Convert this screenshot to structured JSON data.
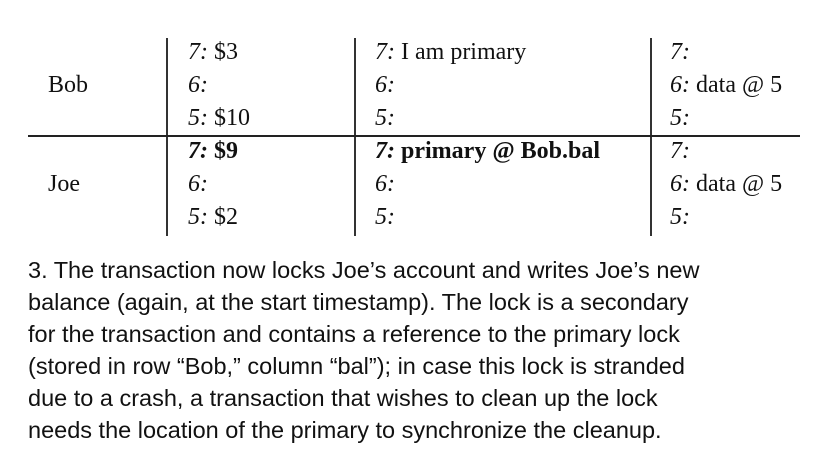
{
  "table": {
    "rows": [
      {
        "label": "Bob",
        "columns": [
          [
            {
              "ts": "7:",
              "val": " $3",
              "bold": false
            },
            {
              "ts": "6:",
              "val": "",
              "bold": false
            },
            {
              "ts": "5:",
              "val": " $10",
              "bold": false
            }
          ],
          [
            {
              "ts": "7:",
              "val": " I am primary",
              "bold": false
            },
            {
              "ts": "6:",
              "val": "",
              "bold": false
            },
            {
              "ts": "5:",
              "val": "",
              "bold": false
            }
          ],
          [
            {
              "ts": "7:",
              "val": "",
              "bold": false
            },
            {
              "ts": "6:",
              "val": " data @ 5",
              "bold": false
            },
            {
              "ts": "5:",
              "val": "",
              "bold": false
            }
          ]
        ]
      },
      {
        "label": "Joe",
        "columns": [
          [
            {
              "ts": "7:",
              "val": " $9",
              "bold": true
            },
            {
              "ts": "6:",
              "val": "",
              "bold": false
            },
            {
              "ts": "5:",
              "val": " $2",
              "bold": false
            }
          ],
          [
            {
              "ts": "7:",
              "val": " primary @ Bob.bal",
              "bold": true
            },
            {
              "ts": "6:",
              "val": "",
              "bold": false
            },
            {
              "ts": "5:",
              "val": "",
              "bold": false
            }
          ],
          [
            {
              "ts": "7:",
              "val": "",
              "bold": false
            },
            {
              "ts": "6:",
              "val": " data @ 5",
              "bold": false
            },
            {
              "ts": "5:",
              "val": "",
              "bold": false
            }
          ]
        ]
      }
    ]
  },
  "paragraph": {
    "lines": [
      "3. The transaction now locks Joe’s account and writes Joe’s new",
      "balance (again, at the start timestamp). The lock is a secondary",
      "for the transaction and contains a reference to the primary lock",
      "(stored in row “Bob,” column “bal”); in case this lock is stranded",
      "due to a crash, a transaction that wishes to clean up the lock",
      "needs the location of the primary to synchronize the cleanup."
    ]
  }
}
